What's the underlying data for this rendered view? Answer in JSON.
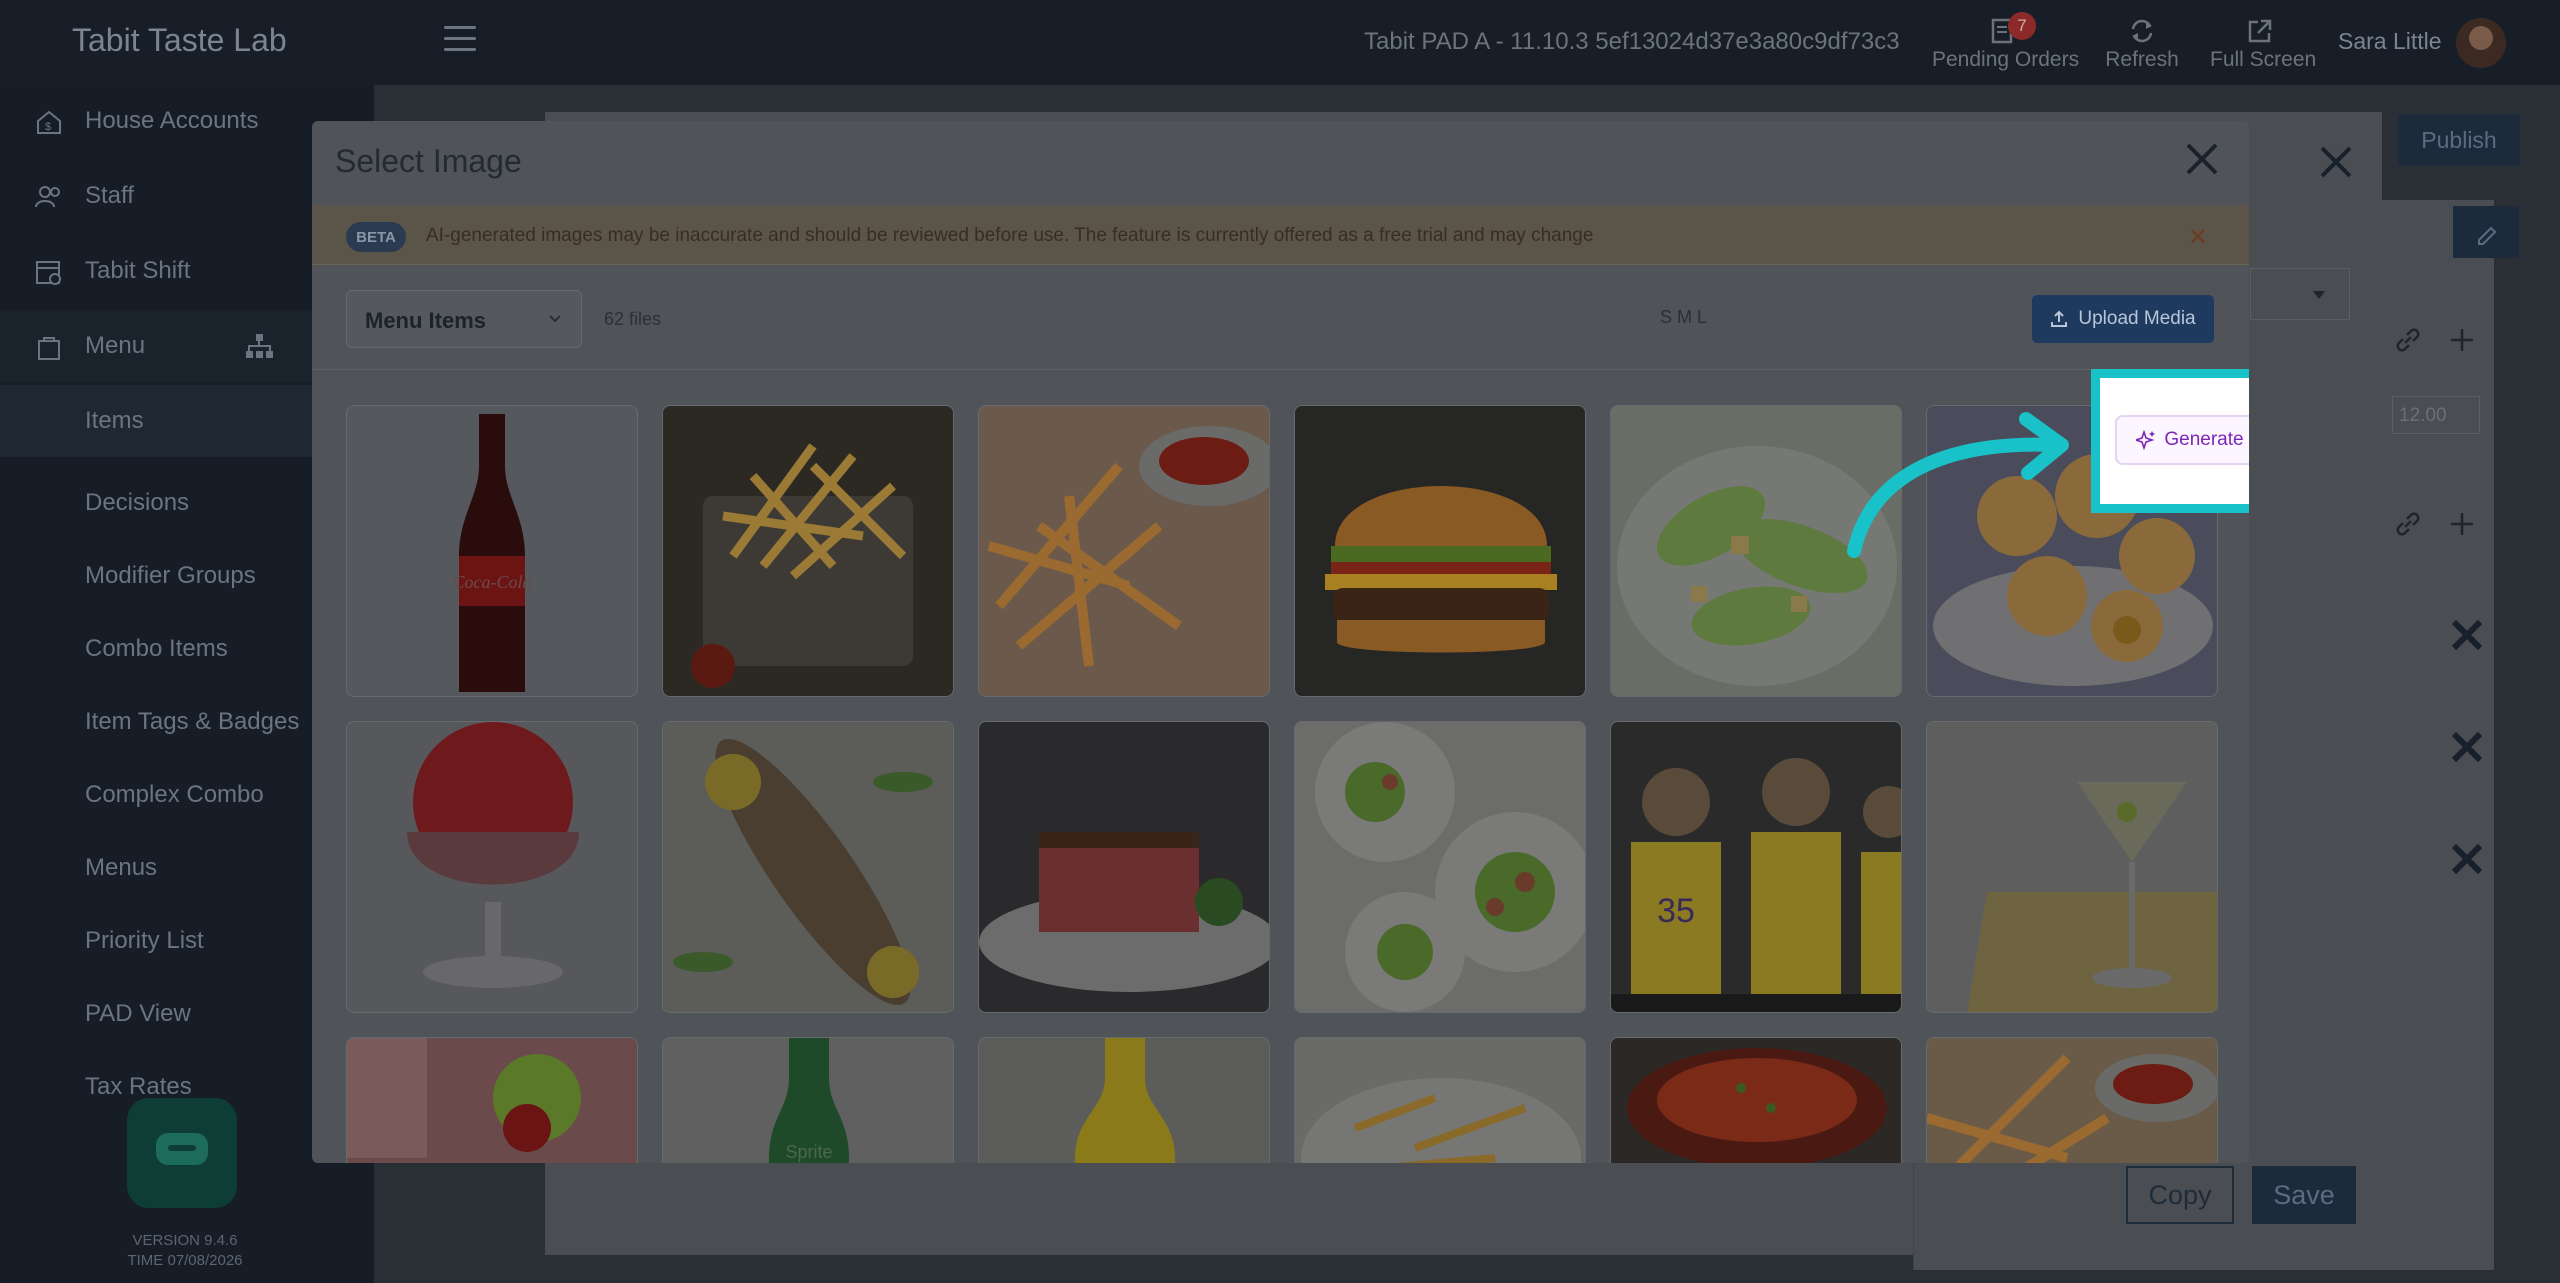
{
  "app": {
    "brand": "Tabit Taste Lab",
    "device": "Tabit PAD A - 11.10.3   5ef13024d37e3a80c9df73c3",
    "pending_orders_label": "Pending Orders",
    "pending_orders_count": "7",
    "refresh_label": "Refresh",
    "fullscreen_label": "Full Screen",
    "user_name": "Sara Little"
  },
  "sidebar": {
    "sections": [
      {
        "label": "House Accounts",
        "icon": "house-accounts-icon"
      },
      {
        "label": "Staff",
        "icon": "staff-icon"
      },
      {
        "label": "Tabit Shift",
        "icon": "calendar-icon"
      },
      {
        "label": "Menu",
        "icon": "menu-bag-icon"
      }
    ],
    "menu_items": [
      "Items",
      "Decisions",
      "Modifier Groups",
      "Combo Items",
      "Item Tags & Badges",
      "Complex Combo",
      "Menus",
      "Priority List",
      "PAD View",
      "Tax Rates"
    ],
    "version": "VERSION 9.4.6",
    "time": "TIME 07/08/2026"
  },
  "background": {
    "publish_label": "Publish",
    "price_value": "12.00",
    "copy_label": "Copy",
    "save_label": "Save"
  },
  "modal": {
    "title": "Select Image",
    "beta_badge": "BETA",
    "beta_text": "AI-generated images may be inaccurate and should be reviewed before use. The feature is currently offered as a free trial and may change",
    "folder_selected": "Menu Items",
    "file_count": "62 files",
    "size_options": "S  M  L",
    "generate_label": "Generate Image",
    "upload_label": "Upload Media"
  },
  "images": [
    "coca-cola-bottle",
    "fries-in-basket",
    "fries-with-ketchup",
    "cheeseburger",
    "caesar-salad",
    "sugar-donut-holes",
    "red-slushie",
    "grilled-fish",
    "steak",
    "salad-plates",
    "basketball-players",
    "martini",
    "cocktail-with-lime",
    "sprite-bottle",
    "orange-soda",
    "pasta",
    "tomato-soup",
    "fries-with-ketchup-2"
  ],
  "colors": {
    "highlight": "#18c2c8",
    "generate_text": "#7d27b3",
    "upload_bg": "#1e3a5e"
  }
}
